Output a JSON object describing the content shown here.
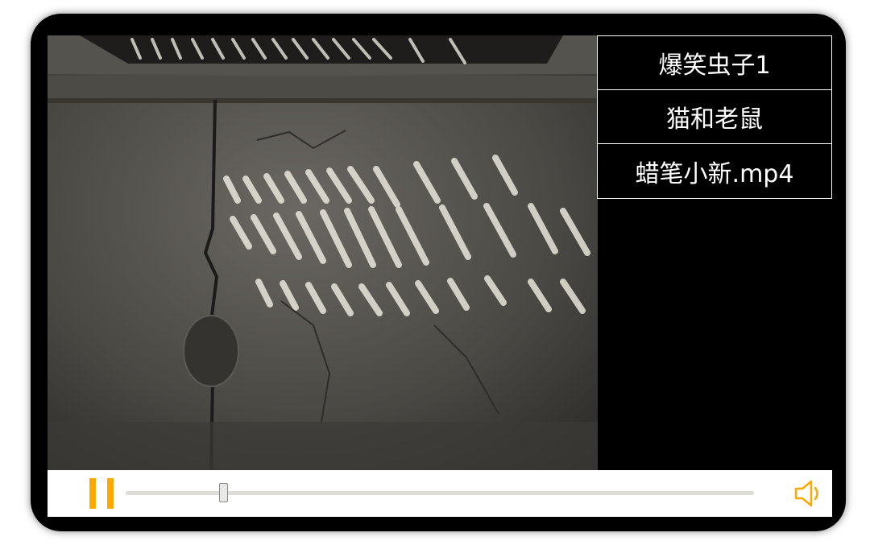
{
  "player": {
    "playing": true,
    "progress_fraction": 0.155
  },
  "playlist": {
    "items": [
      {
        "label": "爆笑虫子1"
      },
      {
        "label": "猫和老鼠"
      },
      {
        "label": "蜡笔小新.mp4"
      }
    ]
  },
  "controls": {
    "pause_icon": "pause-icon",
    "volume_icon": "speaker-icon",
    "accent_color": "#ffa800",
    "track_color": "#deddd8"
  }
}
